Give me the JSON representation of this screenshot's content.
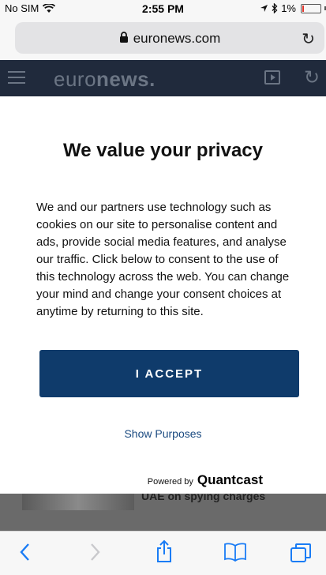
{
  "status": {
    "carrier": "No SIM",
    "time": "2:55 PM",
    "battery": "1%"
  },
  "browser": {
    "url": "euronews.com"
  },
  "site": {
    "logo_light": "euro",
    "logo_bold": "news.",
    "article_title": "UAE on spying charges"
  },
  "consent": {
    "title": "We value your privacy",
    "body": "We and our partners use technology such as cookies on our site to personalise content and ads, provide social media features, and analyse our traffic. Click below to consent to the use of this technology across the web. You can change your mind and change your consent choices at anytime by returning to this site.",
    "accept_label": "I ACCEPT",
    "purposes_label": "Show Purposes",
    "powered_by": "Powered by",
    "brand": "Quantcast"
  },
  "colors": {
    "accent": "#0f3b6b",
    "link": "#1a4a80",
    "site_header": "#202a3c"
  },
  "icons": [
    "wifi-icon",
    "location-icon",
    "bluetooth-icon",
    "battery-icon",
    "lock-icon",
    "reload-icon",
    "menu-icon",
    "play-icon",
    "refresh-icon",
    "back-icon",
    "forward-icon",
    "share-icon",
    "bookmarks-icon",
    "tabs-icon"
  ]
}
